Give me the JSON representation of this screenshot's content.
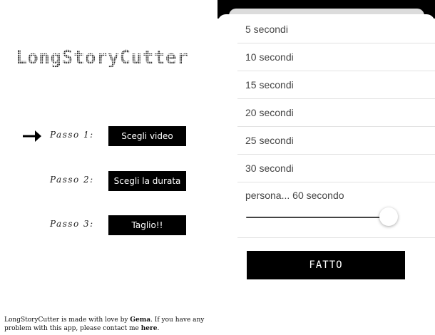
{
  "app": {
    "title": "LongStoryCutter"
  },
  "steps": [
    {
      "label": "Passo 1:",
      "button": "Scegli video",
      "active": true
    },
    {
      "label": "Passo 2:",
      "button": "Scegli la durata",
      "active": false
    },
    {
      "label": "Passo 3:",
      "button": "Taglio!!",
      "active": false
    }
  ],
  "footer": {
    "text_1": "LongStoryCutter is made with love by ",
    "author": "Gema",
    "text_2": ". If you have any problem with this app, please contact me ",
    "link": "here",
    "text_3": "."
  },
  "picker": {
    "options": [
      "5 secondi",
      "10 secondi",
      "15 secondi",
      "20 secondi",
      "25 secondi",
      "30 secondi"
    ],
    "custom_label": "persona... 60 secondo",
    "slider_value_fraction": 0.95,
    "done_label": "FATTO"
  },
  "icons": {
    "active_step": "arrow-right-icon"
  },
  "colors": {
    "button_bg": "#000000",
    "button_text": "#ffffff",
    "separator": "#e2e2e2"
  }
}
